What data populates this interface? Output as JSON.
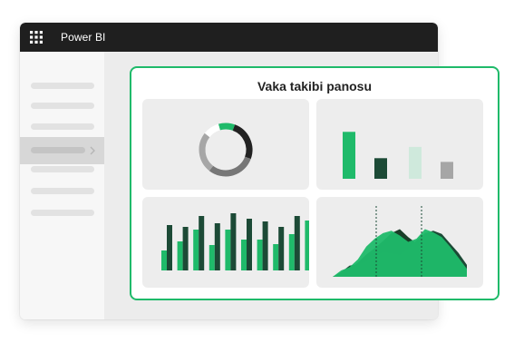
{
  "app": {
    "title": "Power BI",
    "icon": "app-grid-icon"
  },
  "sidebar": {
    "items": [
      {
        "id": "item-1",
        "active": false
      },
      {
        "id": "item-2",
        "active": false
      },
      {
        "id": "item-3",
        "active": false
      },
      {
        "id": "item-4",
        "active": true
      },
      {
        "id": "item-5",
        "active": false
      },
      {
        "id": "item-6",
        "active": false
      },
      {
        "id": "item-7",
        "active": false
      }
    ]
  },
  "dashboard": {
    "title": "Vaka takibi panosu"
  },
  "colors": {
    "accent": "#1fba6a",
    "green": "#1fba6a",
    "dark_green": "#1c4a36",
    "pale_green": "#cfe9dc",
    "gray": "#a6a6a6",
    "dark_gray": "#555555",
    "titlebar": "#1f1f1f"
  },
  "chart_data": [
    {
      "type": "pie",
      "variant": "donut",
      "values": [
        10,
        25,
        30,
        25,
        10
      ],
      "colors": [
        "#1fba6a",
        "#222222",
        "#777777",
        "#a6a6a6",
        "#ffffff"
      ]
    },
    {
      "type": "bar",
      "values": [
        50,
        22,
        34,
        18
      ],
      "colors": [
        "#1fba6a",
        "#1c4a36",
        "#cfe9dc",
        "#a6a6a6"
      ],
      "ylim": [
        0,
        60
      ]
    },
    {
      "type": "bar",
      "series": [
        {
          "values": [
            22,
            32,
            45,
            28,
            45,
            34,
            34,
            29,
            40,
            55
          ]
        },
        {
          "values": [
            50,
            48,
            60,
            52,
            63,
            57,
            54,
            48,
            60,
            65
          ]
        }
      ],
      "colors": [
        "#1fba6a",
        "#1c4a36"
      ],
      "ylim": [
        0,
        70
      ]
    },
    {
      "type": "area",
      "series": [
        {
          "values": [
            0,
            5,
            10,
            18,
            28,
            36,
            45,
            55,
            60,
            50,
            42,
            38,
            32,
            22,
            15,
            6,
            0
          ]
        },
        {
          "values": [
            0,
            6,
            14,
            16,
            20,
            26,
            32,
            30,
            28,
            36,
            46,
            55,
            58,
            54,
            42,
            30,
            15
          ]
        },
        {
          "values": [
            0,
            8,
            12,
            22,
            38,
            48,
            55,
            58,
            52,
            44,
            48,
            60,
            56,
            50,
            38,
            24,
            10
          ]
        }
      ],
      "colors": [
        "#1a3d28",
        "#1c4a36",
        "#1fba6a"
      ],
      "ylim": [
        0,
        80
      ]
    }
  ]
}
